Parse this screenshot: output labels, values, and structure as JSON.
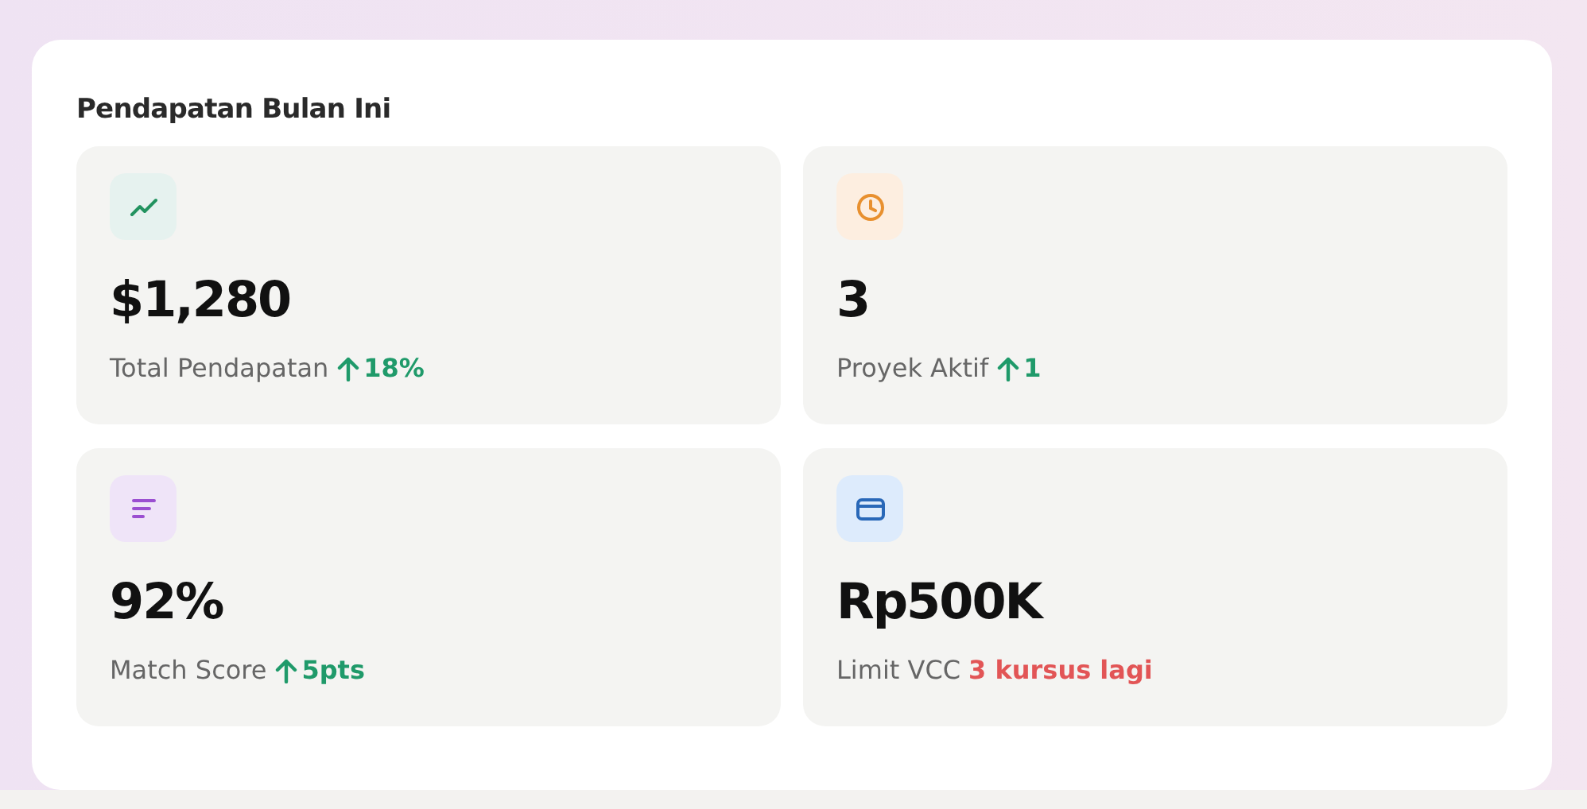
{
  "panel": {
    "title": "Pendapatan Bulan Ini"
  },
  "stats": [
    {
      "kind": "trend",
      "value": "$1,280",
      "label": "Total Pendapatan",
      "delta": {
        "color": "#1f9a6a",
        "arrow": true,
        "text": "18%"
      }
    },
    {
      "kind": "clock",
      "value": "3",
      "label": "Proyek Aktif",
      "delta": {
        "color": "#1f9a6a",
        "arrow": true,
        "text": "1"
      }
    },
    {
      "kind": "bars",
      "value": "92%",
      "label": "Match Score",
      "delta": {
        "color": "#1f9a6a",
        "arrow": true,
        "text": "5pts"
      }
    },
    {
      "kind": "card",
      "value": "Rp500K",
      "label": "Limit VCC",
      "delta": {
        "color": "#e25556",
        "arrow": false,
        "text": "3 kursus lagi"
      }
    }
  ]
}
